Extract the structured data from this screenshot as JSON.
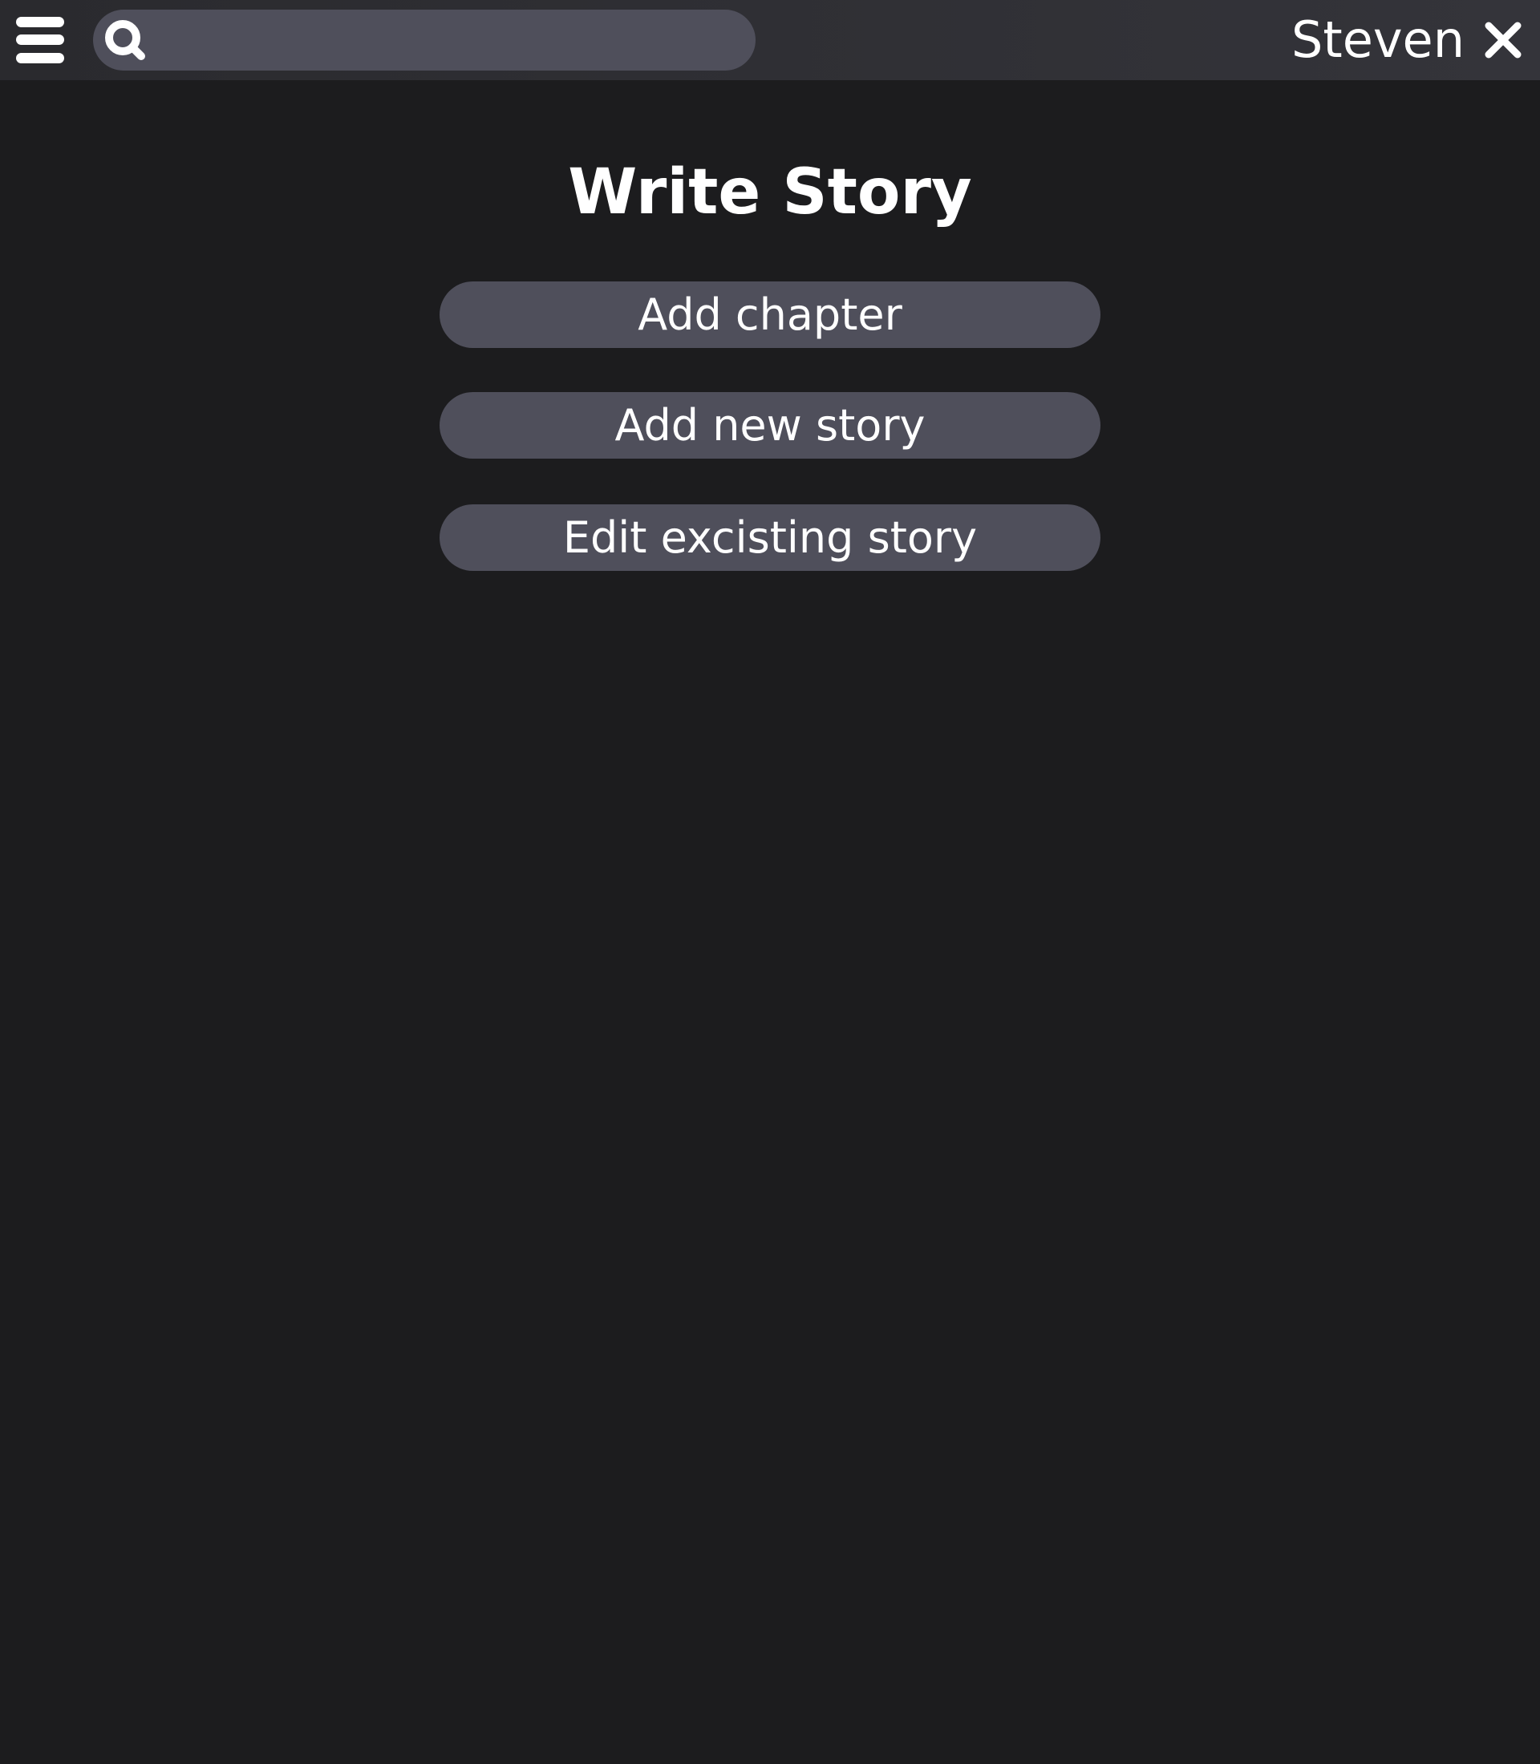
{
  "header": {
    "menu_icon": "hamburger-menu-icon",
    "search": {
      "icon": "search-icon",
      "placeholder": "",
      "value": ""
    },
    "user_name": "Steven",
    "close_icon": "close-icon"
  },
  "main": {
    "title": "Write Story",
    "buttons": [
      {
        "label": "Add chapter"
      },
      {
        "label": "Add new story"
      },
      {
        "label": "Edit excisting story"
      }
    ]
  },
  "colors": {
    "background": "#1c1c1e",
    "topbar": "#2f2f34",
    "control": "#4f4f5b",
    "text": "#ffffff"
  }
}
